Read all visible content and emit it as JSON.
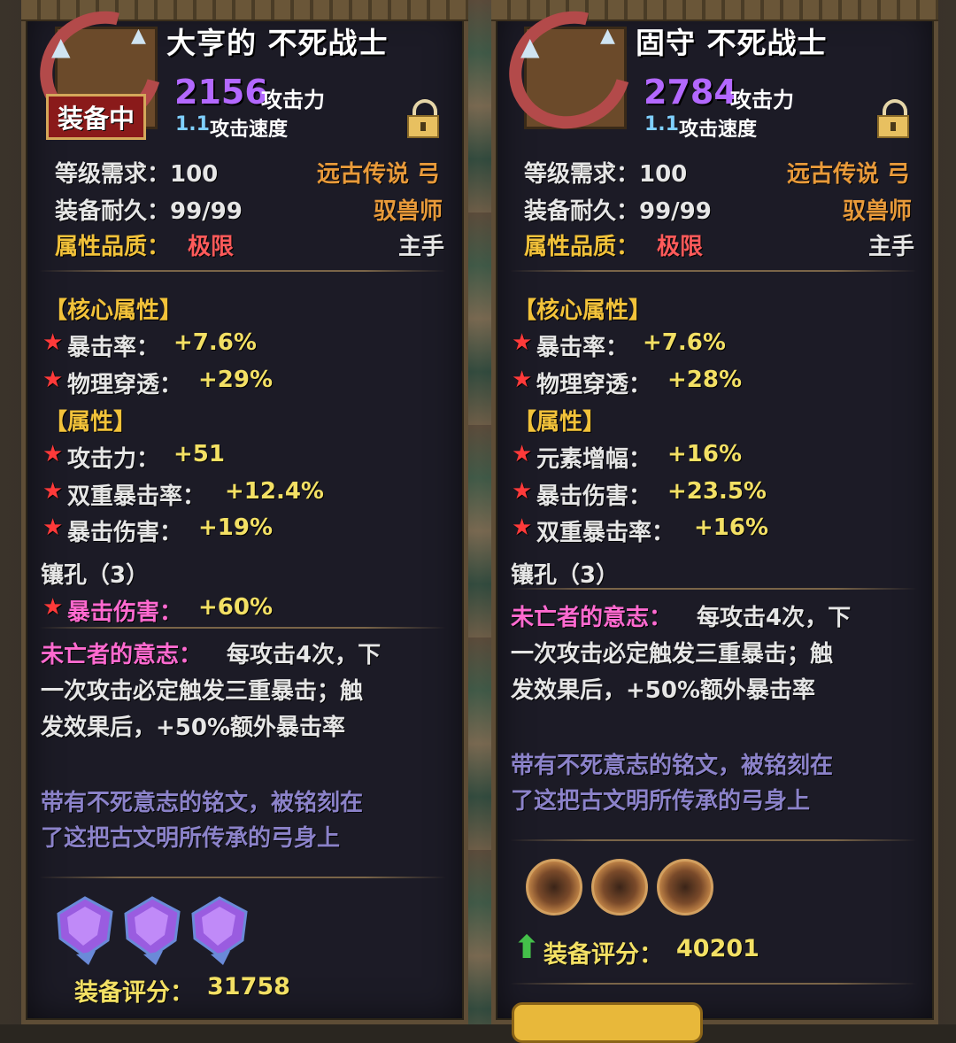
{
  "left": {
    "title": "大亨的 不死战士",
    "equipped_badge": "装备中",
    "attack_value": "2156",
    "attack_label": "攻击力",
    "speed_value": "1.1",
    "speed_label": "攻击速度",
    "level_req": "等级需求：100",
    "durability": "装备耐久：99/99",
    "quality_label": "属性品质：",
    "quality_value": "极限",
    "rarity_type": "远古传说 弓",
    "class": "驭兽师",
    "slot": "主手",
    "core_header": "【核心属性】",
    "core_stats": [
      {
        "name": "暴击率：",
        "value": "+7.6%"
      },
      {
        "name": "物理穿透：",
        "value": "+29%"
      }
    ],
    "attr_header": "【属性】",
    "attr_stats": [
      {
        "name": "攻击力：",
        "value": "+51"
      },
      {
        "name": "双重暴击率：",
        "value": "+12.4%"
      },
      {
        "name": "暴击伤害：",
        "value": "+19%"
      }
    ],
    "sockets_label": "镶孔（3）",
    "socket_stat_name": "暴击伤害：",
    "socket_stat_value": "+60%",
    "skill_name": "未亡者的意志：",
    "skill_line1": "每攻击4次，下",
    "skill_line2": "一次攻击必定触发三重暴击；触",
    "skill_line3": "发效果后，+50%额外暴击率",
    "flavor_line1": "带有不死意志的铭文，被铭刻在",
    "flavor_line2": "了这把古文明所传承的弓身上",
    "gems": [
      "purple-gem-icon",
      "purple-gem-icon",
      "purple-gem-icon"
    ],
    "score_label": "装备评分：",
    "score_value": "31758"
  },
  "right": {
    "title": "固守 不死战士",
    "attack_value": "2784",
    "attack_label": "攻击力",
    "speed_value": "1.1",
    "speed_label": "攻击速度",
    "level_req": "等级需求：100",
    "durability": "装备耐久：99/99",
    "quality_label": "属性品质：",
    "quality_value": "极限",
    "rarity_type": "远古传说 弓",
    "class": "驭兽师",
    "slot": "主手",
    "core_header": "【核心属性】",
    "core_stats": [
      {
        "name": "暴击率：",
        "value": "+7.6%"
      },
      {
        "name": "物理穿透：",
        "value": "+28%"
      }
    ],
    "attr_header": "【属性】",
    "attr_stats": [
      {
        "name": "元素增幅：",
        "value": "+16%"
      },
      {
        "name": "暴击伤害：",
        "value": "+23.5%"
      },
      {
        "name": "双重暴击率：",
        "value": "+16%"
      }
    ],
    "sockets_label": "镶孔（3）",
    "skill_name": "未亡者的意志：",
    "skill_line1": "每攻击4次，下",
    "skill_line2": "一次攻击必定触发三重暴击；触",
    "skill_line3": "发效果后，+50%额外暴击率",
    "flavor_line1": "带有不死意志的铭文，被铭刻在",
    "flavor_line2": "了这把古文明所传承的弓身上",
    "sockets": [
      "empty-socket-icon",
      "empty-socket-icon",
      "empty-socket-icon"
    ],
    "score_label": "装备评分：",
    "score_value": "40201"
  },
  "icons": {
    "star": "★",
    "lock": "lock-icon",
    "arrow": "⬆"
  },
  "colors": {
    "attack_purple": "#b368ff",
    "stat_yellow": "#f3e064",
    "label_gold": "#f2c23a",
    "quality_red": "#ff5a5a",
    "skill_pink": "#ff6ad0",
    "flavor_purple": "#8b82c9",
    "star_red": "#ff3a3a"
  }
}
